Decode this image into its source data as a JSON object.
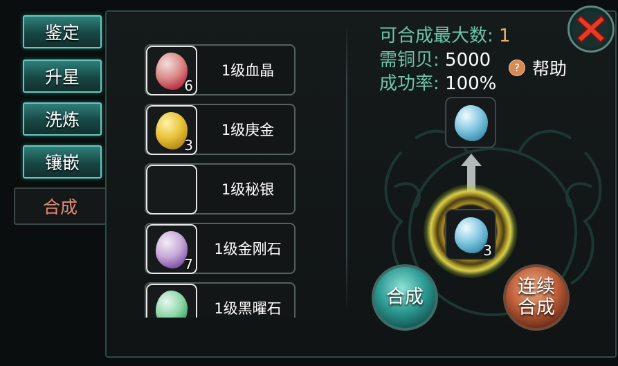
{
  "tabs": [
    {
      "label": "鉴定",
      "active": false
    },
    {
      "label": "升星",
      "active": false
    },
    {
      "label": "洗炼",
      "active": false
    },
    {
      "label": "镶嵌",
      "active": false
    },
    {
      "label": "合成",
      "active": true
    }
  ],
  "materials": [
    {
      "name": "1级血晶",
      "count": "6",
      "color": "#d98a86"
    },
    {
      "name": "1级庚金",
      "count": "3",
      "color": "#e8c23a"
    },
    {
      "name": "1级秘银",
      "count": "",
      "color": ""
    },
    {
      "name": "1级金刚石",
      "count": "7",
      "color": "#c6a8d8"
    },
    {
      "name": "1级黑曜石",
      "count": "",
      "color": "#8fd6a8"
    }
  ],
  "info": {
    "max_label": "可合成最大数:",
    "max_value": "1",
    "cost_label": "需铜贝:",
    "cost_value": "5000",
    "rate_label": "成功率:",
    "rate_value": "100%"
  },
  "help_label": "帮助",
  "result_gem_color": "#7fc6e0",
  "source_gem_count": "3",
  "buttons": {
    "combine": "合成",
    "continuous_line1": "连续",
    "continuous_line2": "合成"
  }
}
